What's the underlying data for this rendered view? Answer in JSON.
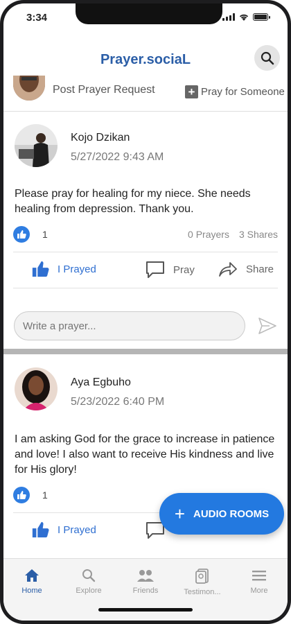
{
  "status": {
    "time": "3:34"
  },
  "header": {
    "title": "Prayer.sociaL"
  },
  "compose": {
    "prompt": "Post Prayer Request",
    "pray_for_label": "Pray for Someone"
  },
  "posts": [
    {
      "author": "Kojo Dzikan",
      "date": "5/27/2022 9:43 AM",
      "text": "Please pray for healing for my niece. She needs healing from depression. Thank you.",
      "likes": "1",
      "prayers": "0 Prayers",
      "shares": "3 Shares",
      "prayed_label": "I Prayed",
      "pray_label": "Pray",
      "share_label": "Share",
      "reply_placeholder": "Write a prayer..."
    },
    {
      "author": "Aya Egbuho",
      "date": "5/23/2022 6:40 PM",
      "text": "I am asking God for the grace to increase in patience and love! I also want to receive His kindness and live for His glory!",
      "likes": "1",
      "prayed_label": "I Prayed"
    }
  ],
  "fab": {
    "label": "AUDIO ROOMS"
  },
  "nav": [
    {
      "label": "Home",
      "icon": "home-icon"
    },
    {
      "label": "Explore",
      "icon": "search-icon"
    },
    {
      "label": "Friends",
      "icon": "friends-icon"
    },
    {
      "label": "Testimon...",
      "icon": "testimony-icon"
    },
    {
      "label": "More",
      "icon": "menu-icon"
    }
  ],
  "colors": {
    "brand": "#2b5ea7",
    "accent": "#2379e0",
    "like": "#2f7de1"
  }
}
